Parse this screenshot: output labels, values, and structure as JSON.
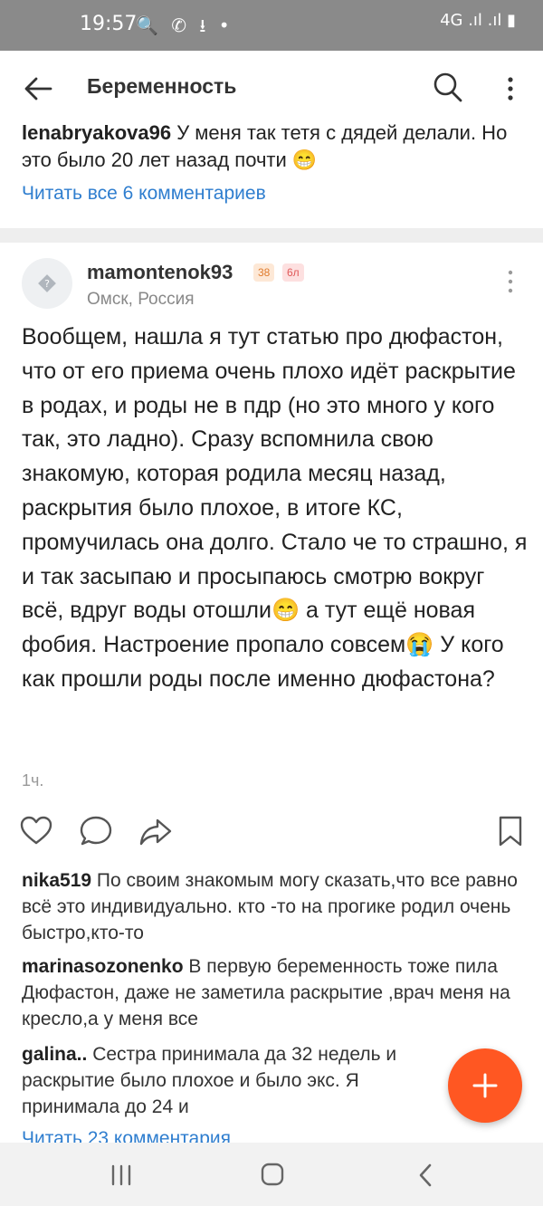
{
  "status_bar": {
    "time": "19:57",
    "left_icons": "🔍 ✆ ⭳ •",
    "right_icons": "4G .ıl .ıl ▮"
  },
  "app_bar": {
    "title": "Беременность"
  },
  "prev_comment": {
    "user": "lenabryakova96",
    "text": " У меня так тетя с дядей делали. Но это было 20 лет назад почти 😁",
    "read_all": "Читать все 6 комментариев"
  },
  "post": {
    "author": "mamontenok93",
    "badges": [
      "38",
      "6л"
    ],
    "location": "Омск, Россия",
    "body": "Вообщем, нашла я тут статью про дюфастон, что от его приема очень плохо идёт раскрытие в родах, и роды не в пдр (но это много у кого так, это ладно). Сразу вспомнила свою знакомую, которая родила месяц назад, раскрытия было плохое, в итоге КС, промучилась она долго. Стало че то страшно, я и так засыпаю и просыпаюсь смотрю вокруг всё, вдруг воды отошли😁 а тут ещё новая фобия. Настроение пропало совсем😭 У кого как прошли роды после именно дюфастона?",
    "time": "1ч."
  },
  "comments": [
    {
      "user": "nika519",
      "text": " По своим знакомым могу сказать,что все равно всё это индивидуально. кто -то на прогике родил очень быстро,кто-то"
    },
    {
      "user": "marinasozonenko",
      "text": " В первую беременность тоже пила Дюфастон, даже не заметила раскрытие ,врач меня на кресло,а у меня все"
    },
    {
      "user": "galina..",
      "text": " Сестра принимала да 32 недель и раскрытие было плохое и было экс. Я принимала до 24 и"
    }
  ],
  "read_all_comments": "Читать 23 комментария",
  "colors": {
    "accent": "#ff5722",
    "link": "#2f7ecf",
    "status_bar": "#8a8a8a"
  }
}
